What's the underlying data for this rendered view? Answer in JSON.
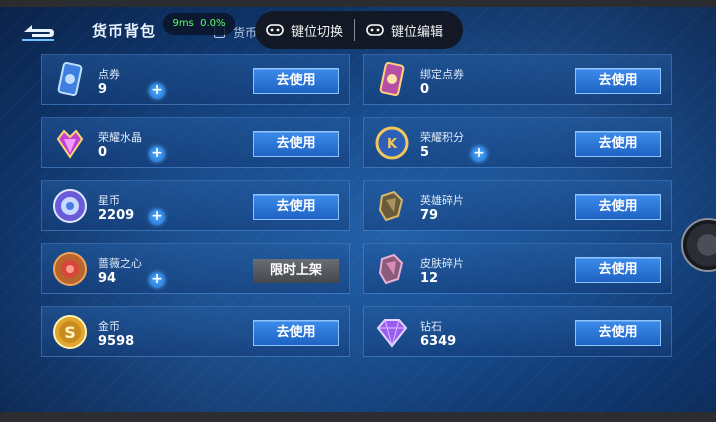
{
  "header": {
    "title": "货币背包",
    "ping": "9ms",
    "loss": "0.0%",
    "subtab_label": "货币",
    "overlay": {
      "key_switch": "键位切换",
      "key_edit": "键位编辑"
    }
  },
  "items": [
    {
      "name": "点券",
      "amount": "9",
      "has_plus": true,
      "action": "去使用",
      "icon": "ticket-icon"
    },
    {
      "name": "绑定点券",
      "amount": "0",
      "has_plus": false,
      "action": "去使用",
      "icon": "bound-ticket-icon"
    },
    {
      "name": "荣耀水晶",
      "amount": "0",
      "has_plus": true,
      "action": "去使用",
      "icon": "crystal-icon"
    },
    {
      "name": "荣耀积分",
      "amount": "5",
      "has_plus": true,
      "action": "去使用",
      "icon": "honor-points-icon"
    },
    {
      "name": "星币",
      "amount": "2209",
      "has_plus": true,
      "action": "去使用",
      "icon": "star-coin-icon"
    },
    {
      "name": "英雄碎片",
      "amount": "79",
      "has_plus": false,
      "action": "去使用",
      "icon": "hero-shard-icon"
    },
    {
      "name": "蔷薇之心",
      "amount": "94",
      "has_plus": true,
      "action": "限时上架",
      "icon": "rose-heart-icon"
    },
    {
      "name": "皮肤碎片",
      "amount": "12",
      "has_plus": false,
      "action": "去使用",
      "icon": "skin-shard-icon"
    },
    {
      "name": "金币",
      "amount": "9598",
      "has_plus": false,
      "action": "去使用",
      "icon": "gold-coin-icon"
    },
    {
      "name": "钻石",
      "amount": "6349",
      "has_plus": false,
      "action": "去使用",
      "icon": "diamond-icon"
    }
  ],
  "colors": {
    "accent": "#2f7fe0",
    "ping_green": "#5bff6a",
    "panel_border": "#6eaaf0"
  }
}
